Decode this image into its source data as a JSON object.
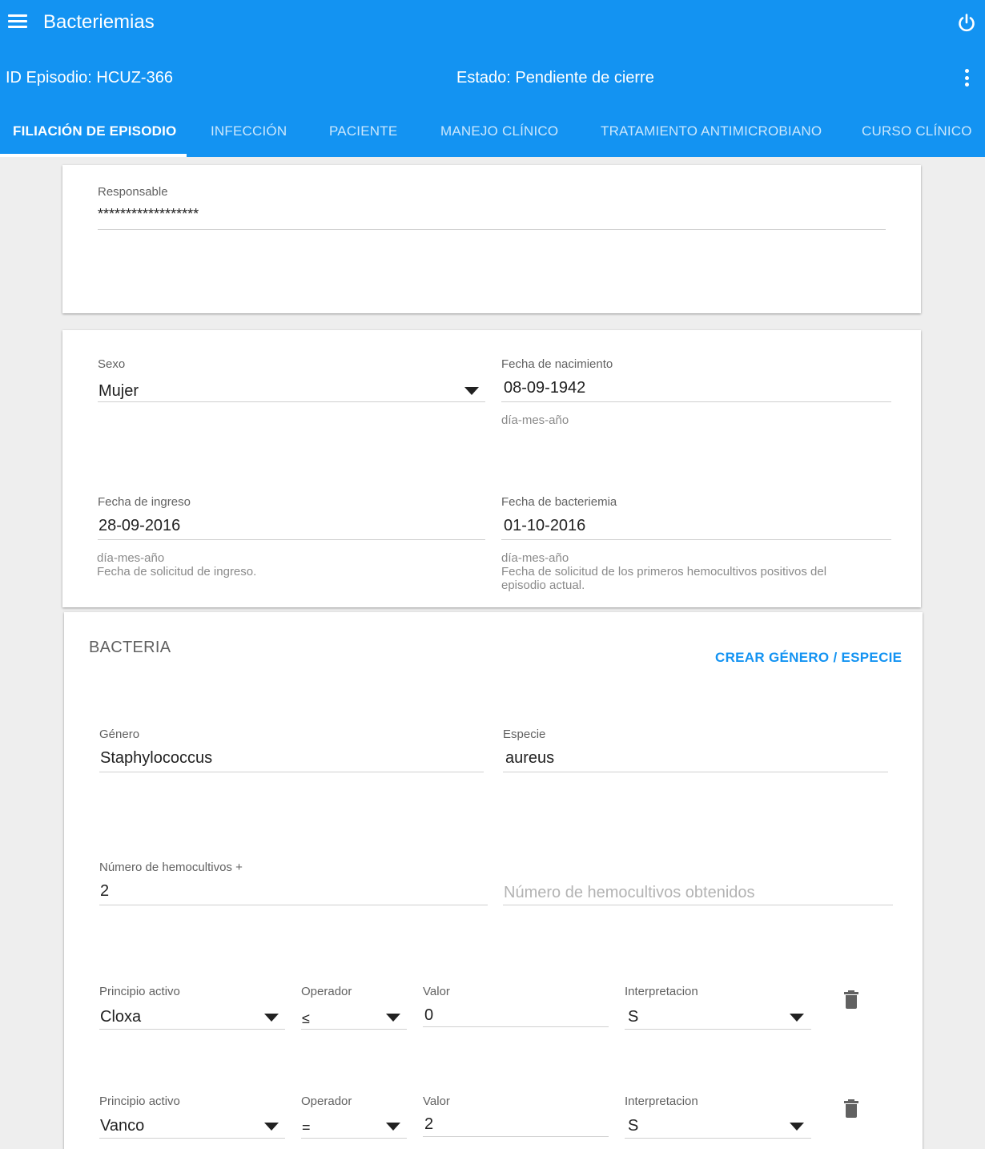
{
  "app": {
    "title": "Bacteriemias"
  },
  "header": {
    "episode_id": "ID Episodio: HCUZ-366",
    "state": "Estado: Pendiente de cierre"
  },
  "tabs": [
    {
      "label": "FILIACIÓN DE EPISODIO",
      "active": true
    },
    {
      "label": "INFECCIÓN",
      "active": false
    },
    {
      "label": "PACIENTE",
      "active": false
    },
    {
      "label": "MANEJO CLÍNICO",
      "active": false
    },
    {
      "label": "TRATAMIENTO ANTIMICROBIANO",
      "active": false
    },
    {
      "label": "CURSO CLÍNICO",
      "active": false
    }
  ],
  "responsable": {
    "label": "Responsable",
    "value": "******************"
  },
  "patient": {
    "sexo": {
      "label": "Sexo",
      "value": "Mujer"
    },
    "fecha_nacimiento": {
      "label": "Fecha de nacimiento",
      "value": "08-09-1942",
      "hint": "día-mes-año"
    },
    "fecha_ingreso": {
      "label": "Fecha de ingreso",
      "value": "28-09-2016",
      "hint1": "día-mes-año",
      "hint2": "Fecha de solicitud de ingreso."
    },
    "fecha_bacteriemia": {
      "label": "Fecha de bacteriemia",
      "value": "01-10-2016",
      "hint1": "día-mes-año",
      "hint2": "Fecha de solicitud de los primeros hemocultivos positivos del episodio actual."
    }
  },
  "bacteria": {
    "title": "BACTERIA",
    "create_button": "CREAR GÉNERO / ESPECIE",
    "genero": {
      "label": "Género",
      "value": "Staphylococcus"
    },
    "especie": {
      "label": "Especie",
      "value": "aureus"
    },
    "hemocultivos_pos": {
      "label": "Número de hemocultivos +",
      "value": "2"
    },
    "hemocultivos_obt": {
      "placeholder": "Número de hemocultivos obtenidos"
    },
    "antibiogram": [
      {
        "principio_label": "Principio activo",
        "principio": "Cloxa",
        "operador_label": "Operador",
        "operador": "≤",
        "valor_label": "Valor",
        "valor": "0",
        "interp_label": "Interpretacion",
        "interp": "S"
      },
      {
        "principio_label": "Principio activo",
        "principio": "Vanco",
        "operador_label": "Operador",
        "operador": "=",
        "valor_label": "Valor",
        "valor": "2",
        "interp_label": "Interpretacion",
        "interp": "S"
      }
    ]
  },
  "colors": {
    "primary": "#1393f2",
    "background": "#eeeeee",
    "card": "#ffffff"
  }
}
